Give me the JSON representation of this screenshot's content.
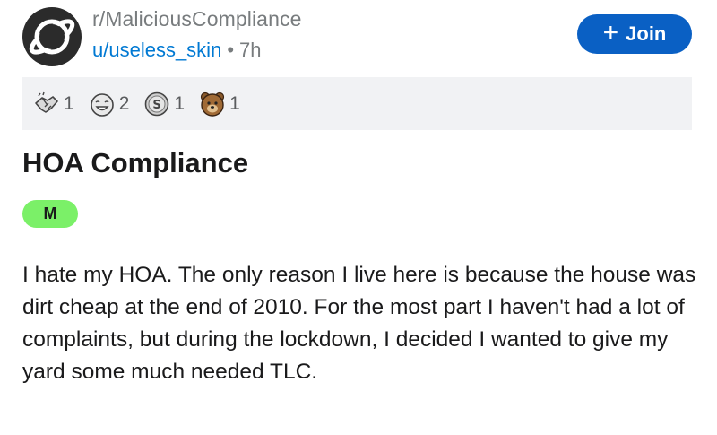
{
  "header": {
    "subreddit": "r/MaliciousCompliance",
    "username": "u/useless_skin",
    "separator": "•",
    "age": "7h",
    "join_label": "Join",
    "join_icon": "plus-icon",
    "subreddit_icon": "planet-icon"
  },
  "awards": [
    {
      "icon": "handshake-award-icon",
      "count": "1"
    },
    {
      "icon": "laughing-face-award-icon",
      "count": "2"
    },
    {
      "icon": "silver-coin-award-icon",
      "count": "1"
    },
    {
      "icon": "bear-face-award-icon",
      "count": "1"
    }
  ],
  "post": {
    "title": "HOA Compliance",
    "flair": "M",
    "flair_color": "#7bf068",
    "body": "I hate my HOA. The only reason I live here is because the house was dirt cheap at the end of 2010. For the most part I haven't had a lot of complaints, but during the lockdown, I decided I wanted to give my yard some much needed TLC."
  },
  "colors": {
    "accent": "#0a60c4",
    "link": "#0079d3",
    "muted": "#787c7e",
    "awards_bg": "#f1f2f4"
  }
}
